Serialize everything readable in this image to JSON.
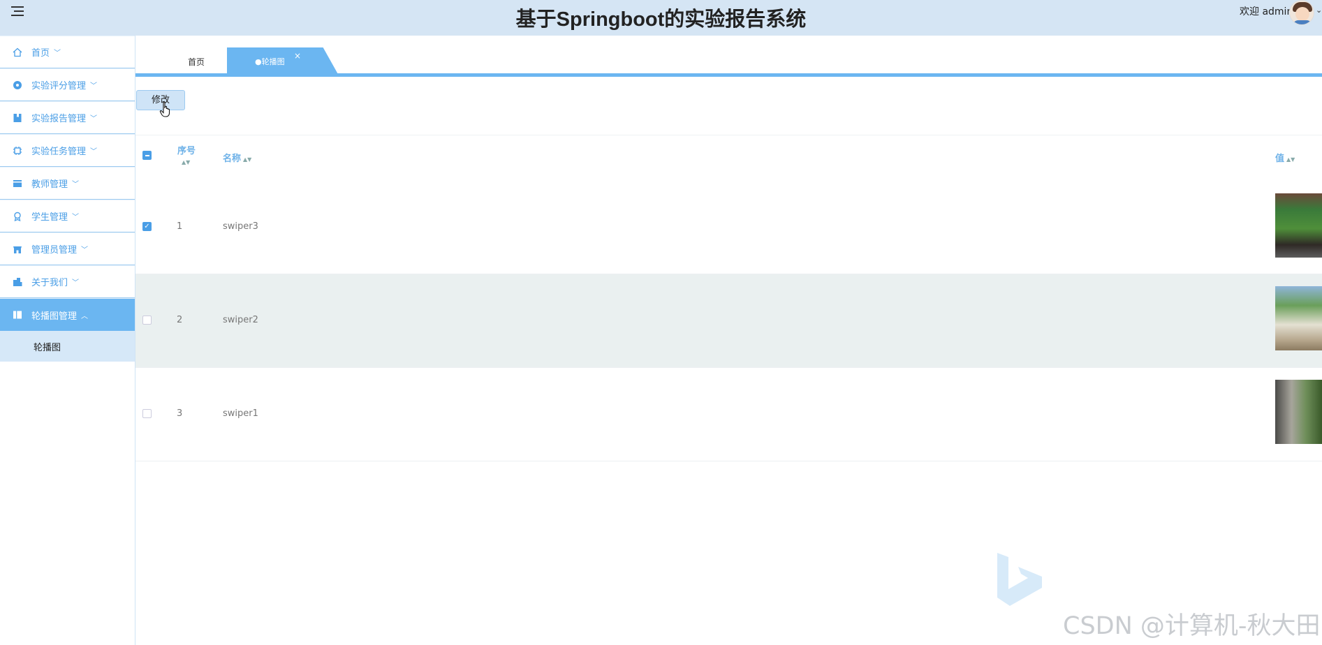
{
  "header": {
    "title": "基于Springboot的实验报告系统",
    "welcome": "欢迎 admin",
    "caret": "⌄"
  },
  "sidebar": {
    "items": [
      {
        "label": "首页",
        "icon": "home-icon"
      },
      {
        "label": "实验评分管理",
        "icon": "circle-icon"
      },
      {
        "label": "实验报告管理",
        "icon": "bookmark-icon"
      },
      {
        "label": "实验任务管理",
        "icon": "chip-icon"
      },
      {
        "label": "教师管理",
        "icon": "card-icon"
      },
      {
        "label": "学生管理",
        "icon": "award-icon"
      },
      {
        "label": "管理员管理",
        "icon": "shop-icon"
      },
      {
        "label": "关于我们",
        "icon": "building-icon"
      },
      {
        "label": "轮播图管理",
        "icon": "panel-icon"
      }
    ],
    "sub_item": "轮播图"
  },
  "tabs": {
    "home": "首页",
    "active": "●轮播图",
    "close": "×"
  },
  "toolbar": {
    "edit_label": "修改"
  },
  "table": {
    "columns": {
      "index": "序号",
      "name": "名称",
      "value": "值"
    },
    "rows": [
      {
        "index": "1",
        "name": "swiper3",
        "checked": true
      },
      {
        "index": "2",
        "name": "swiper2",
        "checked": false
      },
      {
        "index": "3",
        "name": "swiper1",
        "checked": false
      }
    ]
  },
  "watermark": "CSDN @计算机-秋大田",
  "colors": {
    "accent": "#6bb6f1",
    "header_bg": "#d5e5f4",
    "text_blue": "#4a9ee6"
  }
}
